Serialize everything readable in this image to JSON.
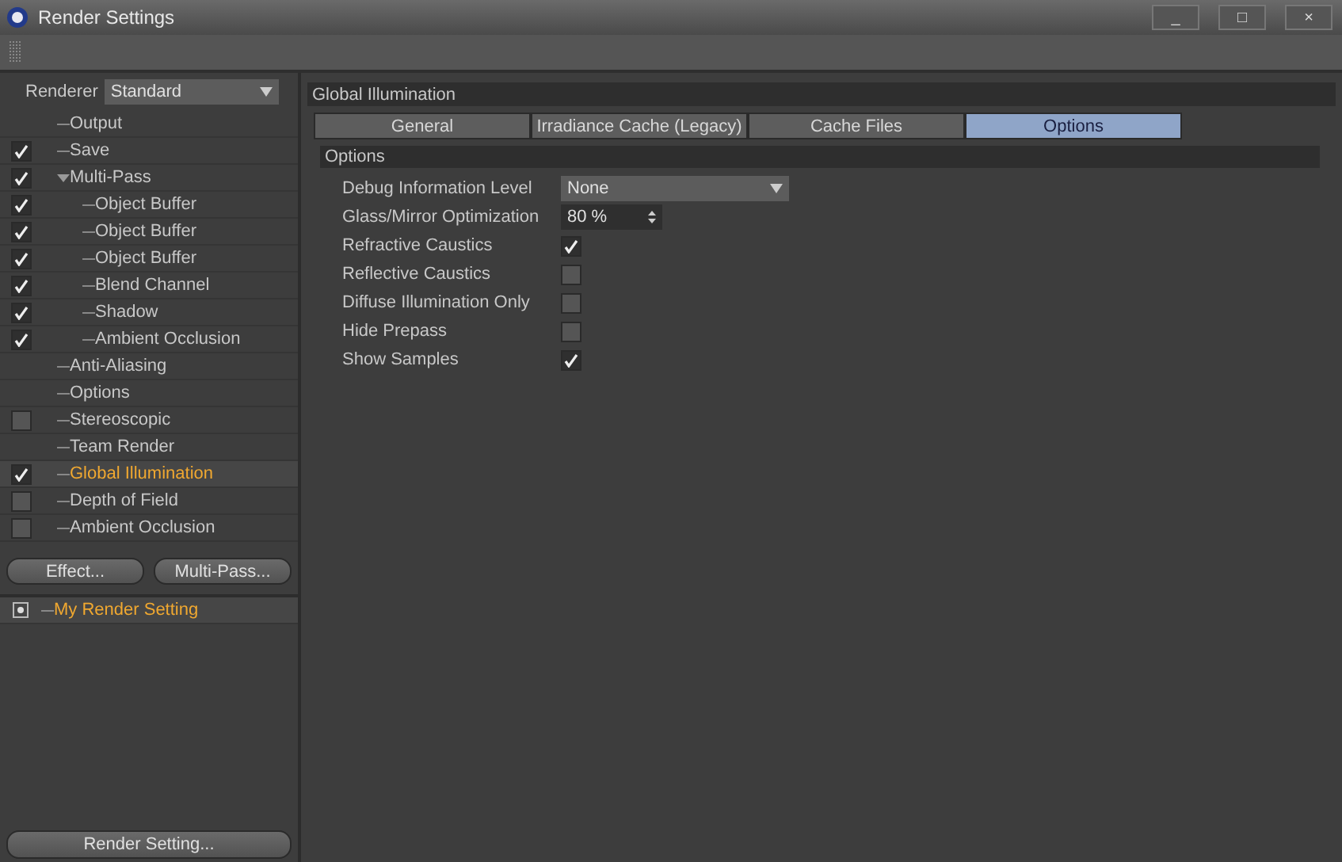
{
  "window": {
    "title": "Render Settings",
    "controls": [
      "_",
      "□",
      "×"
    ]
  },
  "renderer": {
    "label": "Renderer",
    "value": "Standard"
  },
  "tree": [
    {
      "label": "Output",
      "kind": "fixed",
      "selected": false
    },
    {
      "label": "Save",
      "kind": "toggle",
      "checked": true,
      "selected": false
    },
    {
      "label": "Multi-Pass",
      "kind": "toggle",
      "checked": true,
      "selected": false,
      "expanded": true,
      "children": [
        {
          "label": "Object Buffer",
          "kind": "toggle",
          "checked": true,
          "selected": false
        },
        {
          "label": "Object Buffer",
          "kind": "toggle",
          "checked": true,
          "selected": false
        },
        {
          "label": "Object Buffer",
          "kind": "toggle",
          "checked": true,
          "selected": false
        },
        {
          "label": "Blend Channel",
          "kind": "toggle",
          "checked": true,
          "selected": false
        },
        {
          "label": "Shadow",
          "kind": "toggle",
          "checked": true,
          "selected": false
        },
        {
          "label": "Ambient Occlusion",
          "kind": "toggle",
          "checked": true,
          "selected": false
        }
      ]
    },
    {
      "label": "Anti-Aliasing",
      "kind": "fixed",
      "selected": false
    },
    {
      "label": "Options",
      "kind": "fixed",
      "selected": false
    },
    {
      "label": "Stereoscopic",
      "kind": "toggle",
      "checked": false,
      "selected": false
    },
    {
      "label": "Team Render",
      "kind": "fixed",
      "selected": false
    },
    {
      "label": "Global Illumination",
      "kind": "toggle",
      "checked": true,
      "selected": true
    },
    {
      "label": "Depth of Field",
      "kind": "toggle",
      "checked": false,
      "selected": false
    },
    {
      "label": "Ambient Occlusion",
      "kind": "toggle",
      "checked": false,
      "selected": false
    }
  ],
  "buttons": [
    "Effect...",
    "Multi-Pass..."
  ],
  "presets": [
    {
      "label": "My Render Setting",
      "selected": true
    }
  ],
  "bottom_button": "Render Setting...",
  "panel": {
    "title": "Global Illumination",
    "tabs": [
      {
        "label": "General",
        "selected": false
      },
      {
        "label": "Irradiance Cache (Legacy)",
        "selected": false
      },
      {
        "label": "Cache Files",
        "selected": false
      },
      {
        "label": "Options",
        "selected": true
      }
    ],
    "section": "Options",
    "fields": [
      {
        "label": "Debug Information Level",
        "kind": "dropdown",
        "value": "None"
      },
      {
        "label": "Glass/Mirror Optimization",
        "kind": "number",
        "value": "80 %"
      },
      {
        "label": "Refractive Caustics",
        "kind": "checkbox",
        "checked": true
      },
      {
        "label": "Reflective Caustics",
        "kind": "checkbox",
        "checked": false
      },
      {
        "label": "Diffuse Illumination Only",
        "kind": "checkbox",
        "checked": false
      },
      {
        "label": "Hide Prepass",
        "kind": "checkbox",
        "checked": false
      },
      {
        "label": "Show Samples",
        "kind": "checkbox",
        "checked": true
      }
    ]
  }
}
